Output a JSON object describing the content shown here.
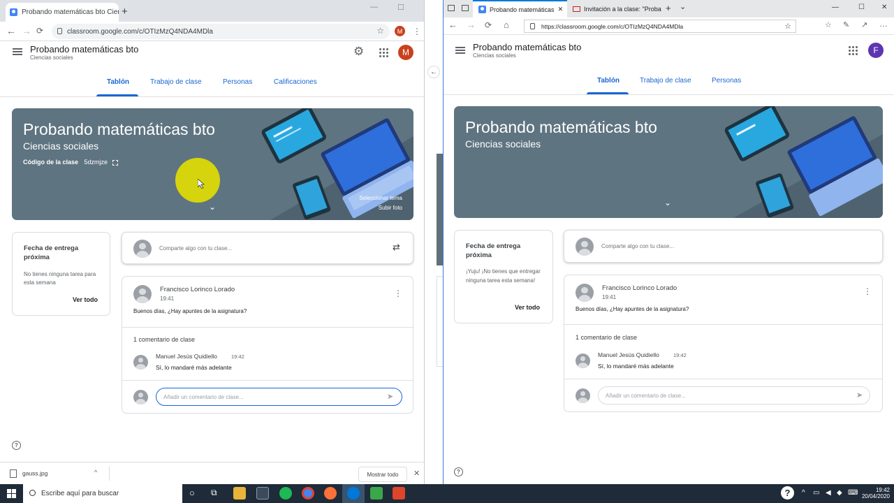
{
  "left_browser": {
    "tab_title": "Probando matemáticas bto Cienc",
    "tab_close": "×",
    "new_tab": "+",
    "window_controls": [
      "—",
      "☐",
      "✕"
    ],
    "nav_back": "←",
    "nav_forward": "→",
    "nav_reload": "⟳",
    "url": "classroom.google.com/c/OTIzMzQ4NDA4MDla",
    "star": "☆",
    "avatar": "M",
    "menu": "⋮"
  },
  "left_classroom": {
    "title": "Probando matemáticas bto",
    "subtitle": "Ciencias sociales",
    "settings_icon": "⚙",
    "avatar": "M",
    "tabs": [
      "Tablón",
      "Trabajo de clase",
      "Personas",
      "Calificaciones"
    ],
    "banner": {
      "title": "Probando matemáticas bto",
      "subtitle": "Ciencias sociales",
      "code_label": "Código de la clase",
      "code_value": "5dzmjze",
      "select_theme": "Seleccionar tema",
      "upload_photo": "Subir foto",
      "chevron": "⌄"
    },
    "due": {
      "heading": "Fecha de entrega próxima",
      "text": "No tienes ninguna tarea para esta semana",
      "link": "Ver todo"
    },
    "share_placeholder": "Comparte algo con tu clase...",
    "swap_icon": "⇄",
    "post": {
      "author": "Francisco Lorinco Lorado",
      "time": "19:41",
      "body": "Buenos días, ¿Hay apuntes de la asignatura?",
      "menu": "⋮",
      "comment_count": "1 comentario de clase",
      "comment_author": "Manuel Jesús Quidiello",
      "comment_time": "19:42",
      "comment_body": "Sí, lo mandaré más adelante",
      "comment_placeholder": "Añadir un comentario de clase...",
      "send": "➤"
    },
    "help": "?"
  },
  "downloads": {
    "file": "gauss.jpg",
    "arrow": "^",
    "show_all": "Mostrar todo",
    "close": "✕"
  },
  "middle": {
    "back": "←"
  },
  "right_browser": {
    "tab1": "Probando matemáticas",
    "tab1_close": "✕",
    "tab2": "Invitación a la clase: \"Probar",
    "new_tab": "+",
    "tab_menu": "⌄",
    "window_controls": [
      "—",
      "☐",
      "✕"
    ],
    "nav_back": "←",
    "nav_forward": "→",
    "nav_reload": "⟳",
    "nav_home": "⌂",
    "url": "https://classroom.google.com/c/OTIzMzQ4NDA4MDla",
    "star": "☆",
    "icons_right": [
      "☆",
      "✎",
      "↗",
      "…"
    ]
  },
  "right_classroom": {
    "title": "Probando matemáticas bto",
    "subtitle": "Ciencias sociales",
    "avatar": "F",
    "tabs": [
      "Tablón",
      "Trabajo de clase",
      "Personas"
    ],
    "banner": {
      "title": "Probando matemáticas bto",
      "subtitle": "Ciencias sociales",
      "chevron": "⌄"
    },
    "due": {
      "heading": "Fecha de entrega próxima",
      "text": "¡Yuju! ¡No tienes que entregar ninguna tarea esta semana!",
      "link": "Ver todo"
    },
    "share_placeholder": "Comparte algo con tu clase...",
    "post": {
      "author": "Francisco Lorinco Lorado",
      "time": "19:41",
      "body": "Buenos días, ¿Hay apuntes de la asignatura?",
      "menu": "⋮",
      "comment_count": "1 comentario de clase",
      "comment_author": "Manuel Jesús Quidiello",
      "comment_time": "19:42",
      "comment_body": "Sí, lo mandaré más adelante",
      "comment_placeholder": "Añadir un comentario de clase...",
      "send": "➤"
    },
    "help": "?"
  },
  "taskbar": {
    "search_placeholder": "Escribe aquí para buscar",
    "cortana": "○",
    "taskview": "⧉",
    "clock_time": "19:42",
    "clock_date": "20/04/2020",
    "help": "?"
  },
  "colors": {
    "accent": "#1967d2",
    "banner": "#5f7481",
    "avatar_m": "#c8411d",
    "avatar_f": "#5e35b1"
  }
}
